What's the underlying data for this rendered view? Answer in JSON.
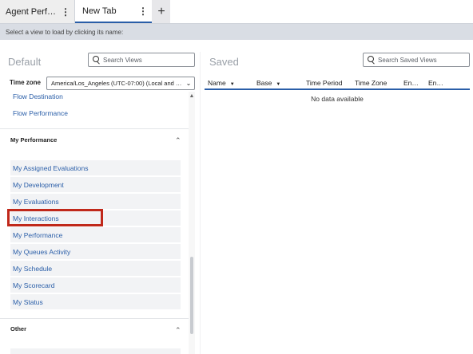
{
  "tabs": [
    {
      "label": "Agent Perform…",
      "menu_icon": "kebab-icon"
    },
    {
      "label": "New Tab",
      "menu_icon": "kebab-icon"
    }
  ],
  "add_tab_icon": "plus-icon",
  "instruction": "Select a view to load by clicking its name:",
  "default_pane": {
    "title": "Default",
    "search_placeholder": "Search Views",
    "timezone_label": "Time zone",
    "timezone_value": "America/Los_Angeles (UTC-07:00) (Local and W…",
    "top_items": [
      "Flow Destination",
      "Flow Performance"
    ],
    "groups": [
      {
        "title": "My Performance",
        "items": [
          "My Assigned Evaluations",
          "My Development",
          "My Evaluations",
          "My Interactions",
          "My Performance",
          "My Queues Activity",
          "My Schedule",
          "My Scorecard",
          "My Status"
        ]
      },
      {
        "title": "Other",
        "items": []
      }
    ]
  },
  "saved_pane": {
    "title": "Saved",
    "search_placeholder": "Search Saved Views",
    "columns": [
      "Name",
      "Base",
      "Time Period",
      "Time Zone",
      "En…",
      "En…"
    ],
    "empty_text": "No data available"
  },
  "colors": {
    "link": "#2a5ea8",
    "highlight": "#c0281a"
  }
}
